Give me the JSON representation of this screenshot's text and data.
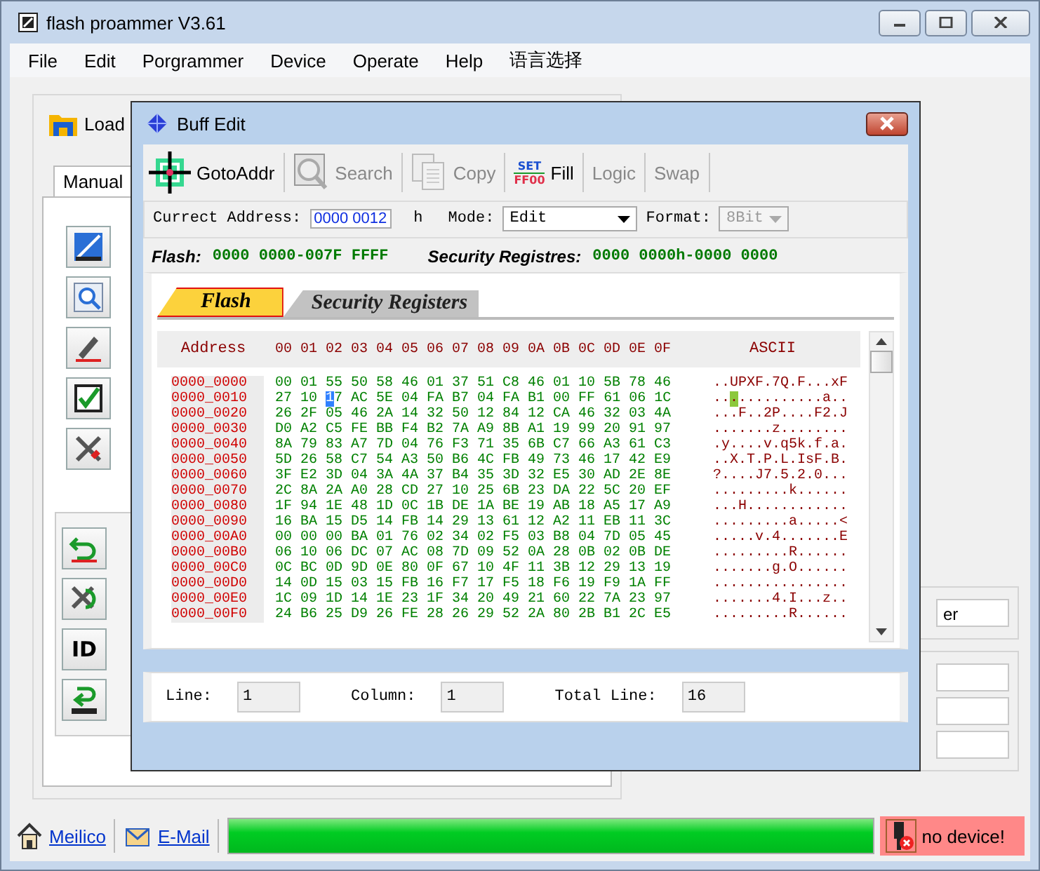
{
  "window": {
    "title": "flash proammer V3.61"
  },
  "menu": [
    "File",
    "Edit",
    "Porgrammer",
    "Device",
    "Operate",
    "Help",
    "语言选择"
  ],
  "main": {
    "load_button": "Load",
    "tabs": [
      {
        "label": "Manual",
        "selected": true
      }
    ],
    "side_buttons": [
      {
        "kind": "erase"
      },
      {
        "kind": "search"
      },
      {
        "kind": "pencil"
      },
      {
        "kind": "check"
      },
      {
        "kind": "tools"
      }
    ],
    "side_buttons_2": [
      {
        "kind": "undo"
      },
      {
        "kind": "tools-arrow"
      },
      {
        "kind": "id",
        "label": "ID"
      },
      {
        "kind": "download"
      }
    ],
    "right_field": "er"
  },
  "dialog": {
    "title": "Buff Edit",
    "toolbar": [
      {
        "kind": "target",
        "label": "GotoAddr",
        "disabled": false
      },
      {
        "kind": "search",
        "label": "Search",
        "disabled": true
      },
      {
        "kind": "copy",
        "label": "Copy",
        "disabled": true
      },
      {
        "kind": "fill",
        "label": "Fill",
        "disabled": false,
        "icon_lines": [
          "SET",
          "FF00"
        ]
      },
      {
        "kind": "text",
        "label": "Logic",
        "disabled": true
      },
      {
        "kind": "text",
        "label": "Swap",
        "disabled": true
      }
    ],
    "address_bar": {
      "address_label": "Currect Address:",
      "address": "0000 0012",
      "unit": "h",
      "mode_label": "Mode:",
      "mode": "Edit",
      "format_label": "Format:",
      "format": "8Bit",
      "format_disabled": true
    },
    "info": {
      "flash_label": "Flash:",
      "flash_range": "0000 0000-007F FFFF",
      "security_label": "Security Registres:",
      "security_range": "0000 0000h-0000 0000"
    },
    "tabs": [
      {
        "label": "Flash",
        "selected": true
      },
      {
        "label": "Security Registers",
        "selected": false
      }
    ],
    "hex": {
      "address_header": "Address",
      "columns_header": "00 01 02 03 04 05 06 07 08 09 0A 0B 0C 0D 0E 0F",
      "ascii_header": "ASCII",
      "rows": [
        {
          "kind": "plain",
          "address": "0000_0000",
          "bytes": "00 01 55 50 58 46 01 37 51 C8 46 01 10 5B 78 46",
          "ascii": "..UPXF.7Q.F...xF"
        },
        {
          "kind": "cursor",
          "address": "0000_0010",
          "bytes_before": "27 10 ",
          "bytes_cursor": "1",
          "bytes_after": "7 AC 5E 04 FA B7 04 FA B1 00 FF 61 06 1C",
          "ascii_before": "..",
          "ascii_cursor": ".",
          "ascii_after": "..........a.."
        },
        {
          "kind": "plain",
          "address": "0000_0020",
          "bytes": "26 2F 05 46 2A 14 32 50 12 84 12 CA 46 32 03 4A",
          "ascii": "...F..2P....F2.J"
        },
        {
          "kind": "plain",
          "address": "0000_0030",
          "bytes": "D0 A2 C5 FE BB F4 B2 7A A9 8B A1 19 99 20 91 97",
          "ascii": ".......z........"
        },
        {
          "kind": "plain",
          "address": "0000_0040",
          "bytes": "8A 79 83 A7 7D 04 76 F3 71 35 6B C7 66 A3 61 C3",
          "ascii": ".y....v.q5k.f.a."
        },
        {
          "kind": "plain",
          "address": "0000_0050",
          "bytes": "5D 26 58 C7 54 A3 50 B6 4C FB 49 73 46 17 42 E9",
          "ascii": "..X.T.P.L.IsF.B."
        },
        {
          "kind": "plain",
          "address": "0000_0060",
          "bytes": "3F E2 3D 04 3A 4A 37 B4 35 3D 32 E5 30 AD 2E 8E",
          "ascii": "?....J7.5.2.0..."
        },
        {
          "kind": "plain",
          "address": "0000_0070",
          "bytes": "2C 8A 2A A0 28 CD 27 10 25 6B 23 DA 22 5C 20 EF",
          "ascii": ".........k......"
        },
        {
          "kind": "plain",
          "address": "0000_0080",
          "bytes": "1F 94 1E 48 1D 0C 1B DE 1A BE 19 AB 18 A5 17 A9",
          "ascii": "...H............"
        },
        {
          "kind": "plain",
          "address": "0000_0090",
          "bytes": "16 BA 15 D5 14 FB 14 29 13 61 12 A2 11 EB 11 3C",
          "ascii": ".........a.....<"
        },
        {
          "kind": "plain",
          "address": "0000_00A0",
          "bytes": "00 00 00 BA 01 76 02 34 02 F5 03 B8 04 7D 05 45",
          "ascii": ".....v.4.......E"
        },
        {
          "kind": "plain",
          "address": "0000_00B0",
          "bytes": "06 10 06 DC 07 AC 08 7D 09 52 0A 28 0B 02 0B DE",
          "ascii": ".........R......"
        },
        {
          "kind": "plain",
          "address": "0000_00C0",
          "bytes": "0C BC 0D 9D 0E 80 0F 67 10 4F 11 3B 12 29 13 19",
          "ascii": ".......g.O......"
        },
        {
          "kind": "plain",
          "address": "0000_00D0",
          "bytes": "14 0D 15 03 15 FB 16 F7 17 F5 18 F6 19 F9 1A FF",
          "ascii": "................"
        },
        {
          "kind": "plain",
          "address": "0000_00E0",
          "bytes": "1C 09 1D 14 1E 23 1F 34 20 49 21 60 22 7A 23 97",
          "ascii": ".......4.I...z.."
        },
        {
          "kind": "plain",
          "address": "0000_00F0",
          "bytes": "24 B6 25 D9 26 FE 28 26 29 52 2A 80 2B B1 2C E5",
          "ascii": ".........R......"
        }
      ]
    },
    "footer": {
      "line_label": "Line:",
      "line": "1",
      "column_label": "Column:",
      "column": "1",
      "total_label": "Total Line:",
      "total": "16"
    }
  },
  "status_bar": {
    "links": [
      {
        "kind": "home",
        "label": "Meilico"
      },
      {
        "kind": "mail",
        "label": "E-Mail"
      }
    ],
    "progress": {
      "level": 1
    },
    "device_status": "no device!"
  }
}
